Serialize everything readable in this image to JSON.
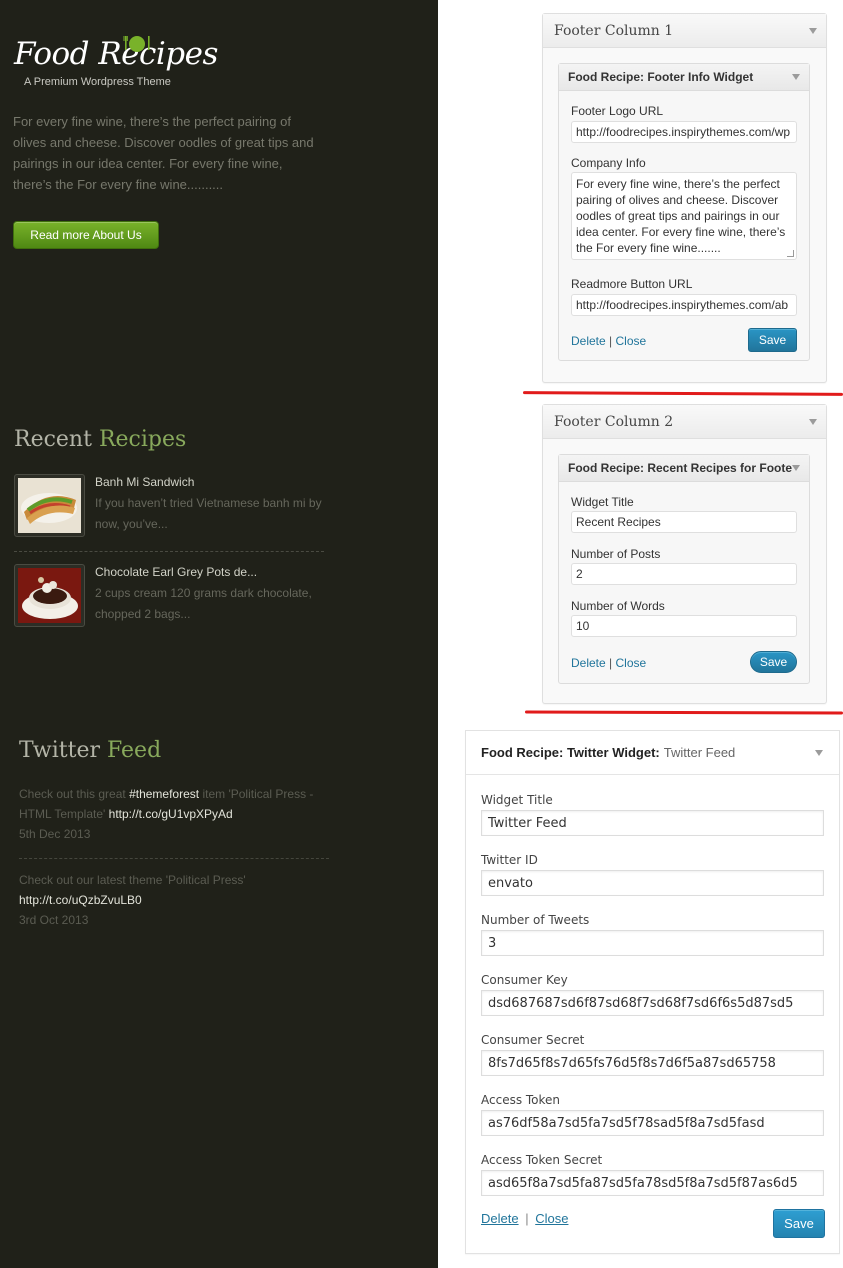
{
  "footer_preview": {
    "logo": {
      "text": "Food Recipes",
      "tagline": "A Premium Wordpress Theme"
    },
    "about_text": "For every fine wine, there’s the perfect pairing of olives and cheese. Discover oodles of great tips and pairings in our idea center. For every fine wine, there’s the For every fine wine..........",
    "read_more_label": "Read more About Us",
    "recent": {
      "title_part1": "Recent ",
      "title_part2": "Recipes",
      "items": [
        {
          "title": "Banh Mi Sandwich",
          "excerpt": "If you haven’t tried Vietnamese banh mi by now, you’ve..."
        },
        {
          "title": "Chocolate Earl Grey Pots de...",
          "excerpt": "2 cups cream 120 grams dark chocolate, chopped 2 bags..."
        }
      ]
    },
    "twitter": {
      "title_part1": "Twitter ",
      "title_part2": "Feed",
      "tweets": [
        {
          "text_a": "Check out this great ",
          "hashtag": "#themeforest",
          "text_b": " item 'Political Press - HTML Template' ",
          "link": "http://t.co/gU1vpXPyAd",
          "date": "5th Dec 2013"
        },
        {
          "text_a": "Check out our latest theme 'Political Press' ",
          "link": "http://t.co/uQzbZvuLB0",
          "date": "3rd Oct 2013"
        }
      ]
    }
  },
  "widgets": {
    "col1": {
      "title": "Footer Column 1",
      "widget_title": "Food Recipe: Footer Info Widget",
      "logo_url_label": "Footer Logo URL",
      "logo_url_value": "http://foodrecipes.inspirythemes.com/wp",
      "company_label": "Company Info",
      "company_value": "For every fine wine, there’s the perfect pairing of olives and cheese. Discover oodles of great tips and pairings in our idea center. For every fine wine, there’s the For every fine wine.......",
      "readmore_label": "Readmore Button URL",
      "readmore_value": "http://foodrecipes.inspirythemes.com/ab",
      "delete": "Delete",
      "sep": " | ",
      "close": "Close",
      "save": "Save"
    },
    "col2": {
      "title": "Footer Column 2",
      "widget_title": "Food Recipe: Recent Recipes for Foote",
      "title_label": "Widget Title",
      "title_value": "Recent Recipes",
      "posts_label": "Number of Posts",
      "posts_value": "2",
      "words_label": "Number of Words",
      "words_value": "10",
      "delete": "Delete",
      "sep": " | ",
      "close": "Close",
      "save": "Save"
    },
    "twitter": {
      "head_main": "Food Recipe: Twitter Widget:",
      "head_sub": "Twitter Feed",
      "fields": [
        {
          "label": "Widget Title",
          "value": "Twitter Feed"
        },
        {
          "label": "Twitter ID",
          "value": "envato"
        },
        {
          "label": "Number of Tweets",
          "value": "3"
        },
        {
          "label": "Consumer Key",
          "value": "dsd687687sd6f87sd68f7sd68f7sd6f6s5d87sd5"
        },
        {
          "label": "Consumer Secret",
          "value": "8fs7d65f8s7d65fs76d5f8s7d6f5a87sd65758"
        },
        {
          "label": "Access Token",
          "value": "as76df58a7sd5fa7sd5f78sad5f8a7sd5fasd"
        },
        {
          "label": "Access Token Secret",
          "value": "asd65f8a7sd5fa87sd5fa78sd5f8a7sd5f87as6d5"
        }
      ],
      "delete": "Delete",
      "sep": "|",
      "close": "Close",
      "save": "Save"
    }
  },
  "colors": {
    "dark_bg": "#202119",
    "accent_green": "#88a95c",
    "button_green": "#5c9a1b",
    "wp_link": "#21759b",
    "wp_save": "#2a95c5",
    "red_divider": "#e11b1b"
  }
}
